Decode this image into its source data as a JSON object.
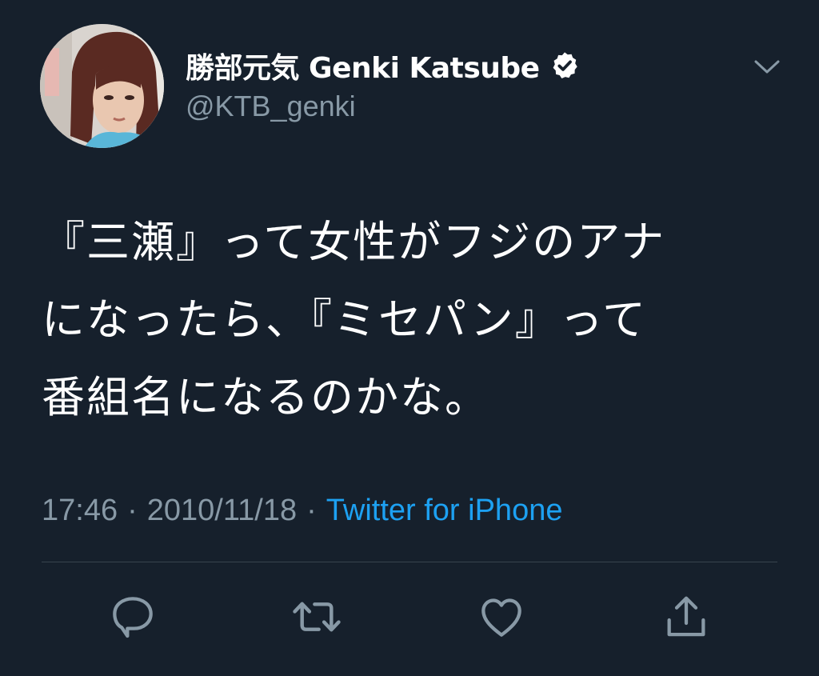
{
  "author": {
    "display_name": "勝部元気 Genki Katsube",
    "handle": "@KTB_genki",
    "verified": true,
    "avatar_icon": "profile-photo"
  },
  "tweet": {
    "lines": [
      "『三瀬』って女性がフジのアナ",
      "になったら、『ミセパン』って",
      "番組名になるのかな。"
    ]
  },
  "meta": {
    "time": "17:46",
    "date": "2010/11/18",
    "separator": "·",
    "source": "Twitter for iPhone"
  },
  "actions": [
    {
      "name": "reply",
      "icon": "speech-bubble-icon"
    },
    {
      "name": "retweet",
      "icon": "retweet-icon"
    },
    {
      "name": "like",
      "icon": "heart-icon"
    },
    {
      "name": "share",
      "icon": "share-icon"
    }
  ],
  "colors": {
    "background": "#16202c",
    "text": "#ffffff",
    "secondary_text": "#8899a6",
    "link": "#1da1f2",
    "divider": "#38444d"
  }
}
